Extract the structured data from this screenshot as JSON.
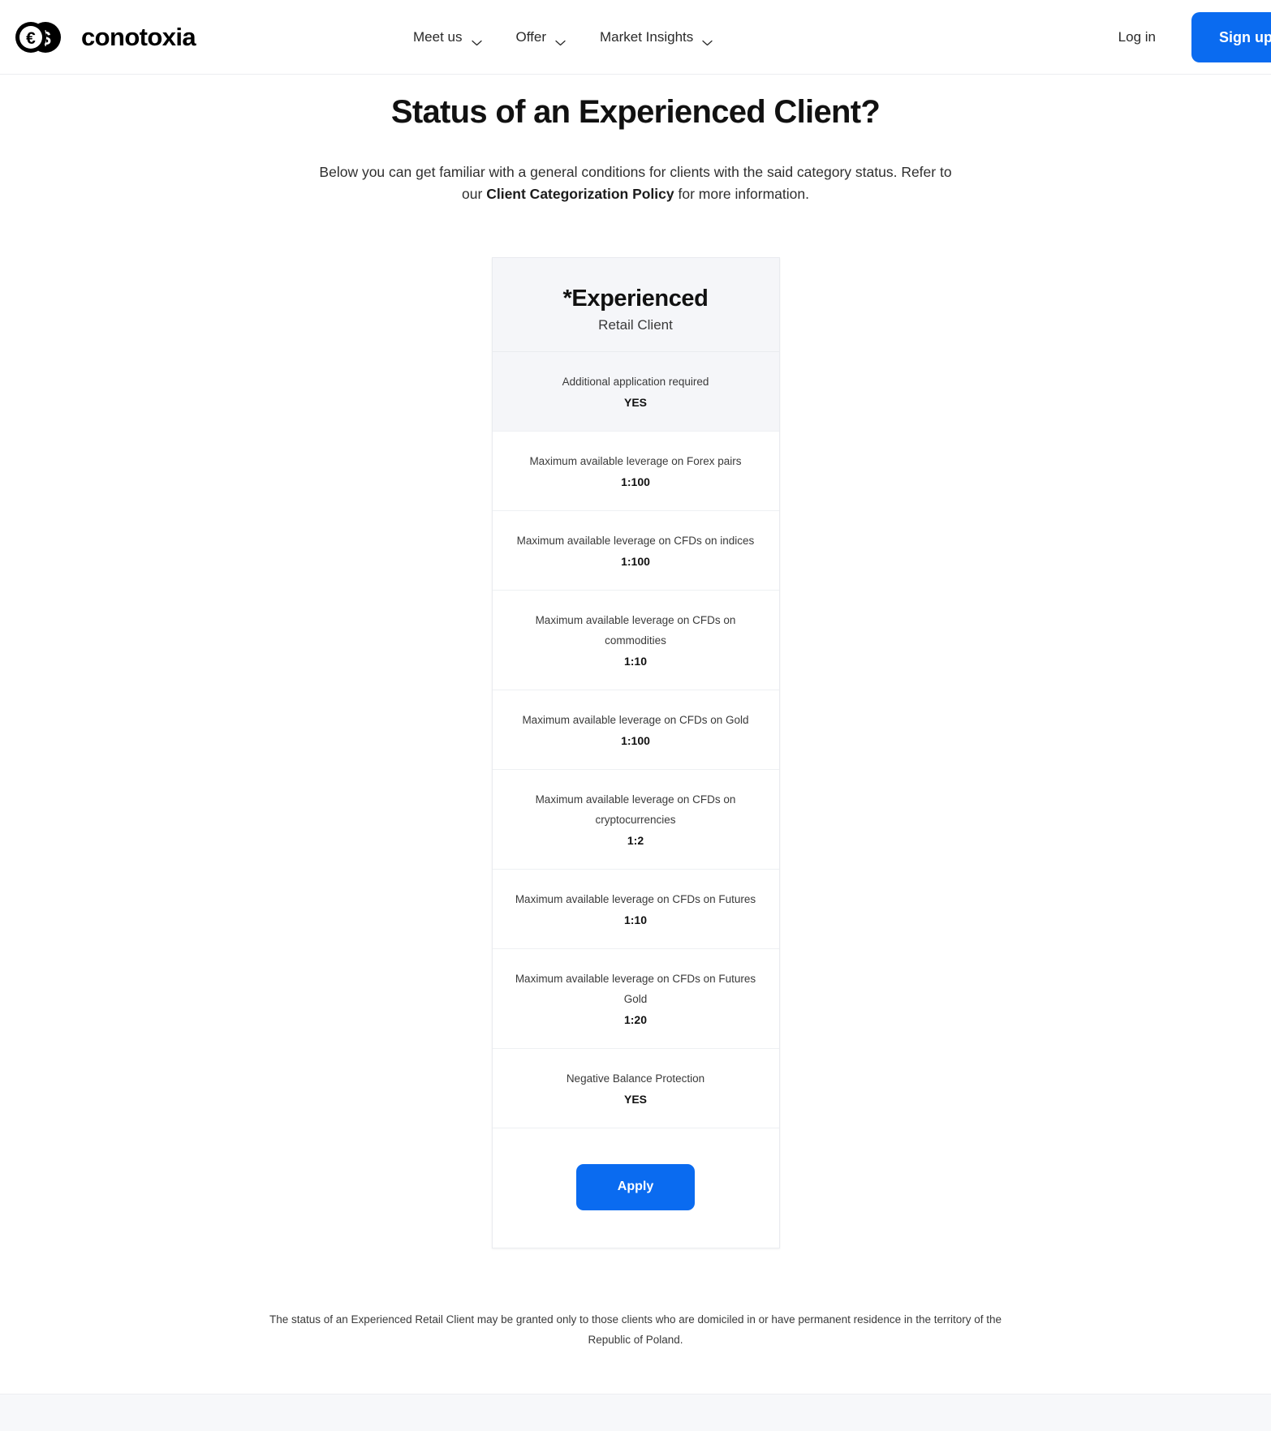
{
  "header": {
    "brand": {
      "name": "conotoxia",
      "euro_symbol": "€",
      "dollar_symbol": "$"
    },
    "nav": [
      {
        "label": "Meet us",
        "has_dropdown": true
      },
      {
        "label": "Offer",
        "has_dropdown": true
      },
      {
        "label": "Market Insights",
        "has_dropdown": true
      }
    ],
    "login_label": "Log in",
    "signup_label": "Sign up free",
    "accent_color": "#0a6bf0"
  },
  "page": {
    "title": "Status of an Experienced Client?",
    "intro_before": "Below you can get familiar with a general conditions for clients with the said category status. Refer to our ",
    "intro_link": "Client Categorization Policy",
    "intro_after": " for more information.",
    "disclaimer": "The status of an Experienced Retail Client may be granted only to those clients who are domiciled in or have permanent residence in the territory of the Republic of Poland."
  },
  "card": {
    "plan_title": "*Experienced",
    "plan_subtitle": "Retail Client",
    "rows": [
      {
        "label": "Additional application required",
        "value": "YES",
        "highlight": true
      },
      {
        "label": "Maximum available leverage on Forex pairs",
        "value": "1:100",
        "highlight": false
      },
      {
        "label": "Maximum available leverage on CFDs on indices",
        "value": "1:100",
        "highlight": false
      },
      {
        "label": "Maximum available leverage on CFDs on commodities",
        "value": "1:10",
        "highlight": false
      },
      {
        "label": "Maximum available leverage on CFDs on Gold",
        "value": "1:100",
        "highlight": false
      },
      {
        "label": "Maximum available leverage on CFDs on cryptocurrencies",
        "value": "1:2",
        "highlight": false
      },
      {
        "label": "Maximum available leverage on CFDs on Futures",
        "value": "1:10",
        "highlight": false
      },
      {
        "label": "Maximum available leverage on CFDs on Futures Gold",
        "value": "1:20",
        "highlight": false
      },
      {
        "label": "Negative Balance Protection",
        "value": "YES",
        "highlight": false
      }
    ],
    "apply_label": "Apply"
  }
}
